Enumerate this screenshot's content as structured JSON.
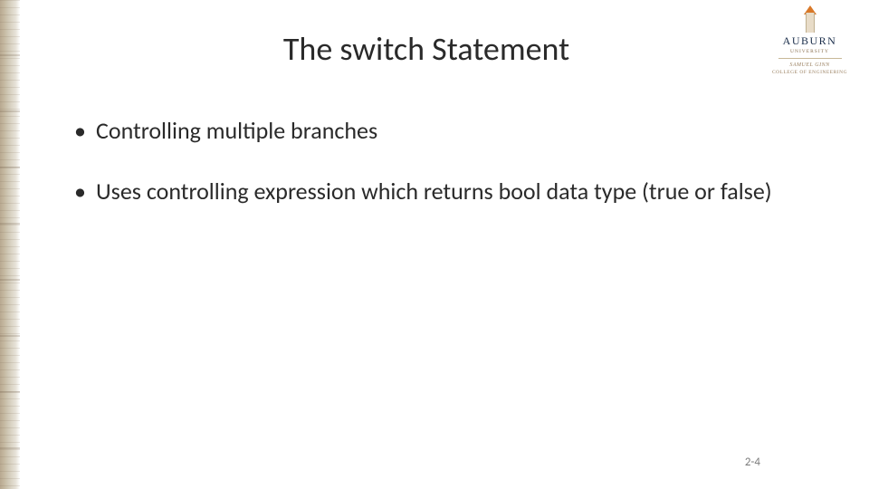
{
  "slide": {
    "title": "The switch Statement",
    "bullets": [
      "Controlling multiple branches",
      "Uses controlling expression which returns bool data type (true or false)"
    ],
    "page_number": "2-4"
  },
  "logo": {
    "wordmark": "AUBURN",
    "subline": "UNIVERSITY",
    "college_name": "SAMUEL GINN",
    "college_of": "COLLEGE OF ENGINEERING"
  }
}
